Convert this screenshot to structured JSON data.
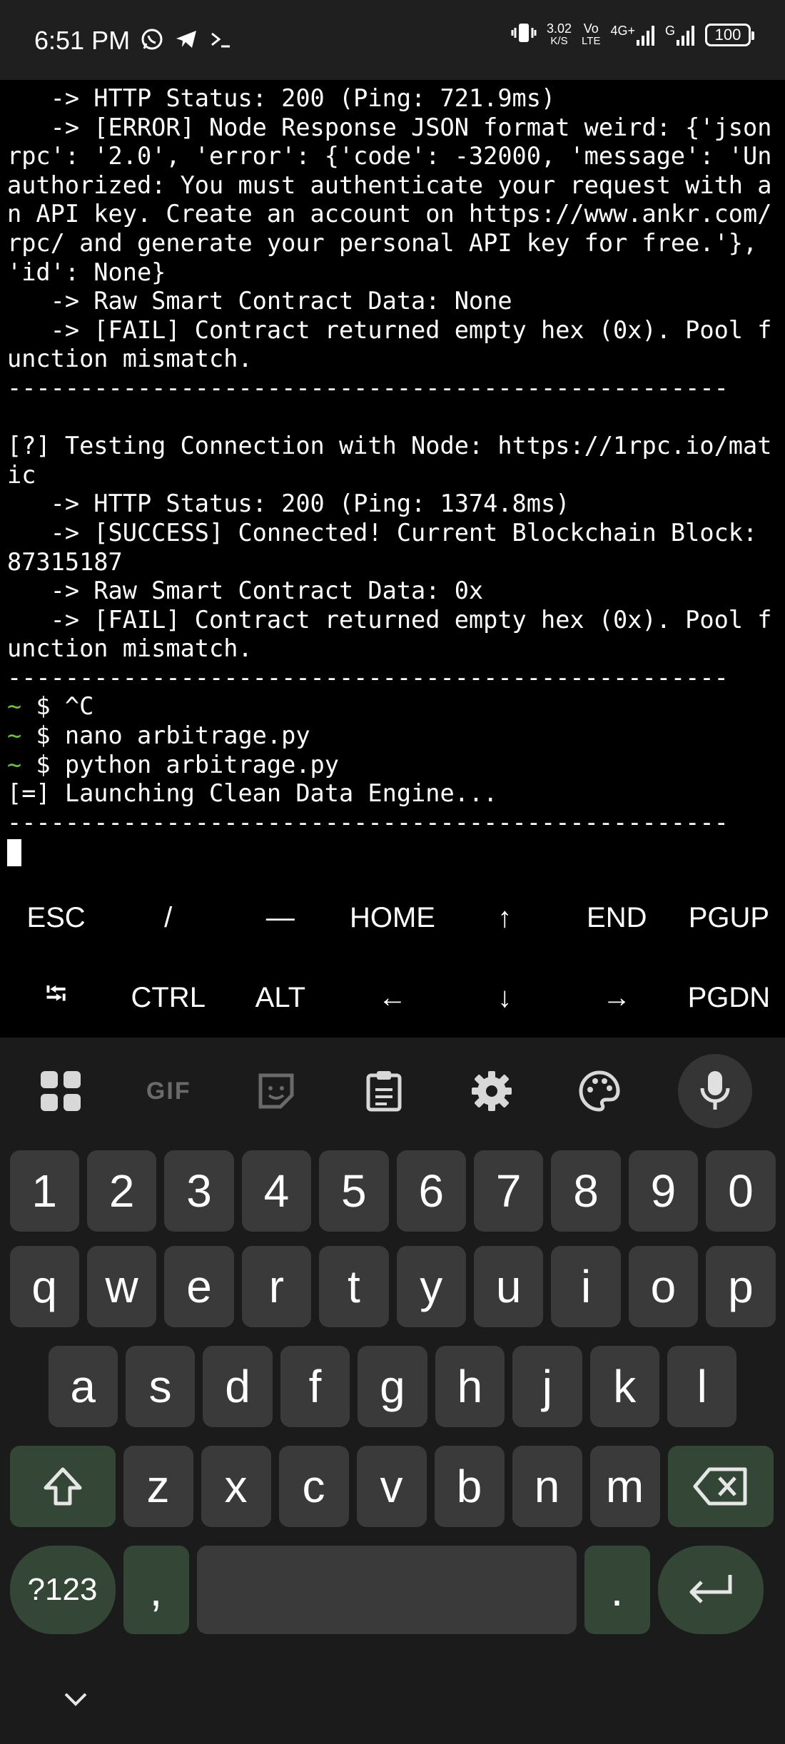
{
  "status_bar": {
    "time": "6:51 PM",
    "speed_value": "3.02",
    "speed_unit": "K/S",
    "volte_top": "Vo",
    "volte_bottom": "LTE",
    "network": "4G+",
    "network2": "G",
    "battery": "100"
  },
  "terminal": {
    "lines": [
      "   -> HTTP Status: 200 (Ping: 721.9ms)",
      "   -> [ERROR] Node Response JSON format weird: {'json",
      "rpc': '2.0', 'error': {'code': -32000, 'message': 'Un",
      "authorized: You must authenticate your request with a",
      "n API key. Create an account on https://www.ankr.com/",
      "rpc/ and generate your personal API key for free.'},",
      "'id': None}",
      "   -> Raw Smart Contract Data: None",
      "   -> [FAIL] Contract returned empty hex (0x). Pool f",
      "unction mismatch.",
      "--------------------------------------------------",
      "",
      "[?] Testing Connection with Node: https://1rpc.io/mat",
      "ic",
      "   -> HTTP Status: 200 (Ping: 1374.8ms)",
      "   -> [SUCCESS] Connected! Current Blockchain Block:",
      "87315187",
      "   -> Raw Smart Contract Data: 0x",
      "   -> [FAIL] Contract returned empty hex (0x). Pool f",
      "unction mismatch.",
      "--------------------------------------------------"
    ],
    "prompt_symbol": "~",
    "prompt_dollar": " $ ",
    "commands": [
      "^C",
      "nano arbitrage.py",
      "python arbitrage.py"
    ],
    "after": [
      "[=] Launching Clean Data Engine...",
      "--------------------------------------------------"
    ]
  },
  "extra_keys": {
    "row1": [
      "ESC",
      "/",
      "—",
      "HOME",
      "↑",
      "END",
      "PGUP"
    ],
    "row2": [
      "⭾",
      "CTRL",
      "ALT",
      "←",
      "↓",
      "→",
      "PGDN"
    ]
  },
  "keyboard": {
    "toolbar_gif": "GIF",
    "row_numbers": [
      "1",
      "2",
      "3",
      "4",
      "5",
      "6",
      "7",
      "8",
      "9",
      "0"
    ],
    "row_q": [
      "q",
      "w",
      "e",
      "r",
      "t",
      "y",
      "u",
      "i",
      "o",
      "p"
    ],
    "row_a": [
      "a",
      "s",
      "d",
      "f",
      "g",
      "h",
      "j",
      "k",
      "l"
    ],
    "row_z": [
      "z",
      "x",
      "c",
      "v",
      "b",
      "n",
      "m"
    ],
    "symbols_label": "?123",
    "comma": ",",
    "period": "."
  }
}
